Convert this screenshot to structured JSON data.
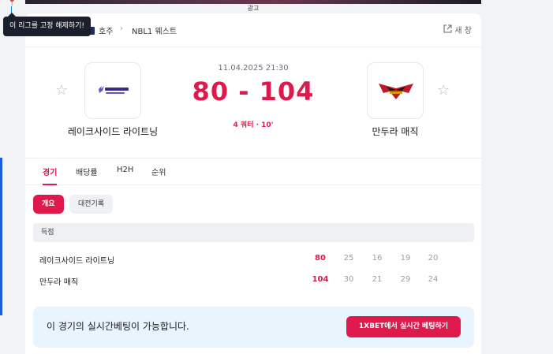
{
  "ad": {
    "label": "광고"
  },
  "tooltip": {
    "text": "이 리그를 고정 해제하기!"
  },
  "breadcrumb": {
    "country": "호주",
    "separator": "›",
    "league": "NBL1 웨스트"
  },
  "header": {
    "new_window_label": "새 창",
    "new_window_icon": "external-link-icon"
  },
  "match": {
    "date": "11.04.2025 21:30",
    "score": "80 - 104",
    "status": "4 쿼터 · 10'",
    "home": {
      "name": "레이크사이드 라이트닝",
      "logo_text": "LAKESIDE"
    },
    "away": {
      "name": "만두라 매직"
    }
  },
  "tabs": [
    {
      "label": "경기",
      "active": true
    },
    {
      "label": "배당률",
      "active": false
    },
    {
      "label": "H2H",
      "active": false
    },
    {
      "label": "순위",
      "active": false
    }
  ],
  "subtabs": [
    {
      "label": "개요",
      "active": true
    },
    {
      "label": "대전기록",
      "active": false
    }
  ],
  "scoreboard": {
    "header": "득점",
    "rows": [
      {
        "team": "레이크사이드 라이트닝",
        "total": "80",
        "quarters": [
          "25",
          "16",
          "19",
          "20"
        ]
      },
      {
        "team": "만두라 매직",
        "total": "104",
        "quarters": [
          "30",
          "21",
          "29",
          "24"
        ]
      }
    ]
  },
  "betting": {
    "message": "이 경기의 실시간베팅이 가능합니다.",
    "button_label": "1XBET에서 실시간 베팅하기"
  },
  "colors": {
    "accent": "#e0194d",
    "bet_bg": "#eaf4fd",
    "tooltip_bg": "#1a1f2b"
  }
}
